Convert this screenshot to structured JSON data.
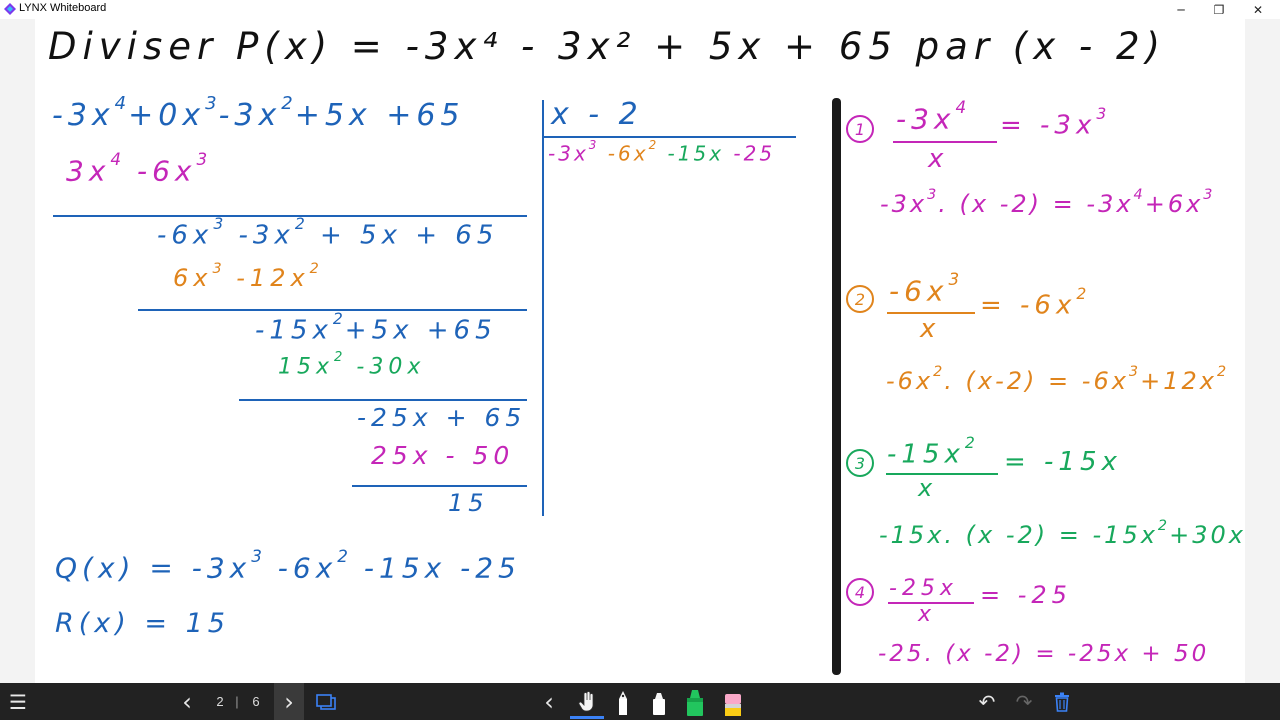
{
  "window": {
    "title": "LYNX Whiteboard",
    "minimize_glyph": "─",
    "maximize_glyph": "❐",
    "close_glyph": "✕"
  },
  "board": {
    "heading": "Diviser P(x) = -3x⁴ - 3x² + 5x + 65 par (x - 2)",
    "division": {
      "dividend": [
        "-3x",
        "4",
        "+0x",
        "3",
        "-3x",
        "2",
        "+5x +65"
      ],
      "line1": [
        "3x",
        "4",
        " -6x",
        "3"
      ],
      "line2": [
        "-6x",
        "3",
        " -3x",
        "2",
        " + 5x + 65"
      ],
      "line3": [
        "6x",
        "3",
        " -12x",
        "2"
      ],
      "line4": [
        "-15x",
        "2",
        "+5x +65"
      ],
      "line5": [
        "15x",
        "2",
        " -30x"
      ],
      "line6": "-25x + 65",
      "line7": "25x - 50",
      "remainder_value": "15",
      "divisor": "x - 2",
      "quotient_parts": [
        "-3x",
        "3",
        " -6x",
        "2",
        " -15x",
        " -25"
      ]
    },
    "results": {
      "q_label": "Q(x) = -3x",
      "q_exp": "3",
      "q_rest_a": " -6x",
      "q_exp2": "2",
      "q_rest_b": " -15x  -25",
      "r_label": "R(x) = 15"
    },
    "steps": [
      {
        "num": "1",
        "numer": "-3x",
        "numer_exp": "4",
        "denom": "x",
        "result": "= -3x",
        "result_exp": "3",
        "mult": "-3x",
        "mult_exp": "3",
        "mult_rest": ". (x -2) = -3x",
        "mult_exp2": "4",
        "mult_tail": "+6x",
        "mult_exp3": "3",
        "color": "#c426b8"
      },
      {
        "num": "2",
        "numer": "-6x",
        "numer_exp": "3",
        "denom": "x",
        "result": "= -6x",
        "result_exp": "2",
        "mult": "-6x",
        "mult_exp": "2",
        "mult_rest": ". (x-2) = -6x",
        "mult_exp2": "3",
        "mult_tail": "+12x",
        "mult_exp3": "2",
        "color": "#e0841c"
      },
      {
        "num": "3",
        "numer": "-15x",
        "numer_exp": "2",
        "denom": "x",
        "result": "= -15x",
        "result_exp": "",
        "mult": "-15x",
        "mult_exp": "",
        "mult_rest": ". (x -2) = -15x",
        "mult_exp2": "2",
        "mult_tail": "+30x",
        "mult_exp3": "",
        "color": "#18a85c"
      },
      {
        "num": "4",
        "numer": "-25x",
        "numer_exp": "",
        "denom": "x",
        "result": "= -25",
        "result_exp": "",
        "mult": "-25",
        "mult_exp": "",
        "mult_rest": ". (x -2) = -25x + 50",
        "mult_exp2": "",
        "mult_tail": "",
        "mult_exp3": "",
        "color": "#c426b8"
      }
    ]
  },
  "toolbar": {
    "menu_icon": "☰",
    "prev_icon": "‹",
    "current_page": "2",
    "separator": "|",
    "total_pages": "6",
    "next_icon": "›",
    "collapse_icon": "‹",
    "undo_icon": "↶",
    "redo_icon": "↷",
    "colors": {
      "highlighter": "#22c55e",
      "eraser": "#f9a8c8",
      "accent": "#3b82f6"
    }
  }
}
